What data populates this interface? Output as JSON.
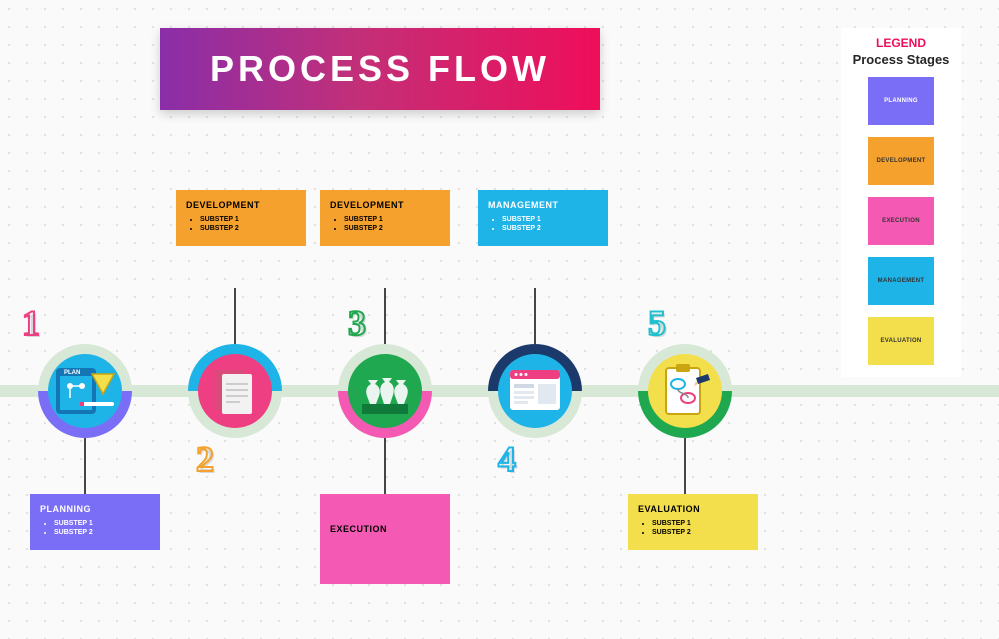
{
  "title": "PROCESS FLOW",
  "legend": {
    "title": "LEGEND",
    "subtitle": "Process Stages",
    "items": [
      {
        "label": "PLANNING",
        "color_class": "c-planning"
      },
      {
        "label": "DEVELOPMENT",
        "color_class": "c-development"
      },
      {
        "label": "EXECUTION",
        "color_class": "c-execution"
      },
      {
        "label": "MANAGEMENT",
        "color_class": "c-management"
      },
      {
        "label": "EVALUATION",
        "color_class": "c-evaluation"
      }
    ]
  },
  "steps": [
    {
      "n": "1",
      "num_class": "num-pink",
      "below_num": false
    },
    {
      "n": "2",
      "num_class": "num-orange",
      "below_num": true
    },
    {
      "n": "3",
      "num_class": "num-green",
      "below_num": false
    },
    {
      "n": "4",
      "num_class": "num-blue",
      "below_num": true
    },
    {
      "n": "5",
      "num_class": "num-teal",
      "below_num": false
    }
  ],
  "cards": {
    "planning": {
      "title": "PLANNING",
      "subs": [
        "SUBSTEP 1",
        "SUBSTEP 2"
      ]
    },
    "dev1": {
      "title": "DEVELOPMENT",
      "subs": [
        "SUBSTEP 1",
        "SUBSTEP 2"
      ]
    },
    "dev2": {
      "title": "DEVELOPMENT",
      "subs": [
        "SUBSTEP 1",
        "SUBSTEP 2"
      ]
    },
    "management": {
      "title": "MANAGEMENT",
      "subs": [
        "SUBSTEP 1",
        "SUBSTEP 2"
      ]
    },
    "execution": {
      "title": "EXECUTION",
      "subs": []
    },
    "evaluation": {
      "title": "EVALUATION",
      "subs": [
        "SUBSTEP 1",
        "SUBSTEP 2"
      ]
    }
  },
  "chart_data": {
    "type": "process-flow",
    "title": "PROCESS FLOW",
    "stages": [
      {
        "order": 1,
        "name": "PLANNING",
        "color": "#7b6ef6",
        "substeps": [
          "SUBSTEP 1",
          "SUBSTEP 2"
        ]
      },
      {
        "order": 2,
        "name": "DEVELOPMENT",
        "color": "#f5a12e",
        "substeps": [
          "SUBSTEP 1",
          "SUBSTEP 2"
        ]
      },
      {
        "order": 3,
        "name": "EXECUTION",
        "color": "#f45ab3",
        "substeps": []
      },
      {
        "order": 4,
        "name": "MANAGEMENT",
        "color": "#1fb4e7",
        "substeps": [
          "SUBSTEP 1",
          "SUBSTEP 2"
        ]
      },
      {
        "order": 5,
        "name": "EVALUATION",
        "color": "#f3df4b",
        "substeps": [
          "SUBSTEP 1",
          "SUBSTEP 2"
        ]
      }
    ],
    "development_appears_twice": true,
    "legend": [
      "PLANNING",
      "DEVELOPMENT",
      "EXECUTION",
      "MANAGEMENT",
      "EVALUATION"
    ]
  }
}
